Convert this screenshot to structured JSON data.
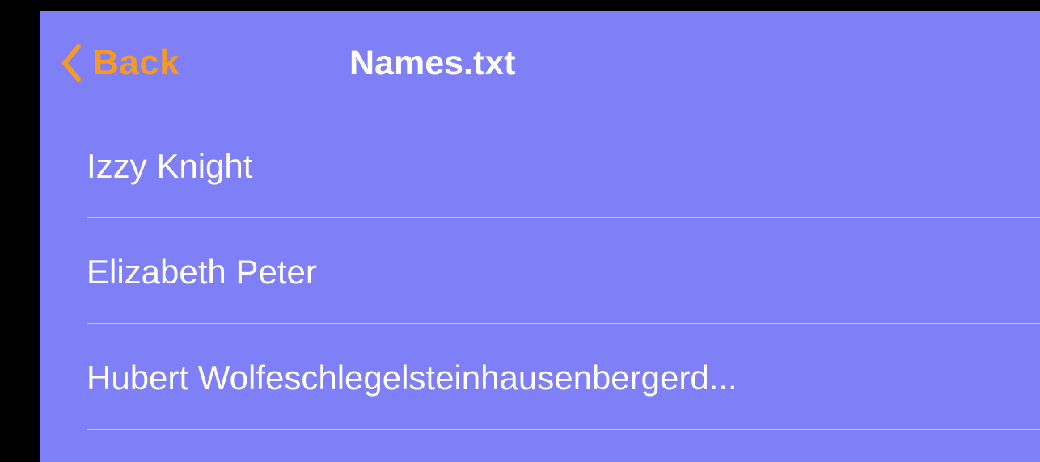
{
  "colors": {
    "background": "#7f7ff8",
    "accent": "#f79a23",
    "text": "#ffffff"
  },
  "nav": {
    "back_label": "Back",
    "back_icon": "chevron-left-icon",
    "title": "Names.txt"
  },
  "list": {
    "items": [
      {
        "label": "Izzy Knight"
      },
      {
        "label": "Elizabeth Peter"
      },
      {
        "label": "Hubert Wolfeschlegelsteinhausenbergerd..."
      }
    ]
  }
}
